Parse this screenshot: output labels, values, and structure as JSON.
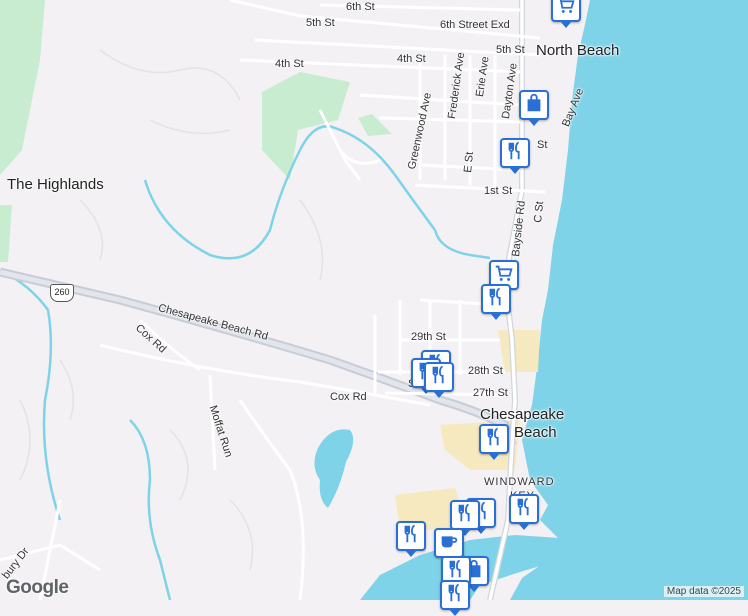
{
  "map": {
    "places": {
      "north_beach": "North Beach",
      "the_highlands": "The Highlands",
      "chesapeake_line1": "Chesapeake",
      "chesapeake_line2": "Beach",
      "windward_line1": "WINDWARD",
      "windward_line2": "KEY"
    },
    "streets": {
      "s6th": "6th St",
      "s6th_exd": "6th Street Exd",
      "s5th_a": "5th St",
      "s5th_b": "5th St",
      "s4th_a": "4th St",
      "s4th_b": "4th St",
      "s1st": "1st St",
      "s29th": "29th St",
      "s28th": "28th St",
      "s27th": "27th St",
      "chesapeake_beach_rd": "Chesapeake Beach Rd",
      "cox_rd_a": "Cox Rd",
      "cox_rd_b": "Cox Rd",
      "moffat_run": "Moffat Run",
      "greenwood_ave": "Greenwood Ave",
      "frederick_ave": "Frederick Ave",
      "erie_ave": "Erie Ave",
      "dayton_ave": "Dayton Ave",
      "bay_ave": "Bay Ave",
      "bayside_rd": "Bayside Rd",
      "c_st": "C St",
      "e_st": "E St",
      "d_st_partial": "St",
      "bury_dr": "bury Dr",
      "s_partial": "S"
    },
    "route_shield": "260",
    "colors": {
      "water": "#7fd3e8",
      "land": "#f3f1f4",
      "park": "#c8ecd0",
      "highway": "#c8ccd6",
      "sand": "#f6e9bf",
      "pin_border": "#2a6fd6"
    }
  },
  "markers": [
    {
      "icon": "cart-icon"
    },
    {
      "icon": "shopping-bag-icon"
    },
    {
      "icon": "restaurant-icon"
    },
    {
      "icon": "cart-icon"
    },
    {
      "icon": "restaurant-icon"
    },
    {
      "icon": "restaurant-icon"
    },
    {
      "icon": "restaurant-icon"
    },
    {
      "icon": "restaurant-icon"
    },
    {
      "icon": "restaurant-icon"
    },
    {
      "icon": "restaurant-icon"
    },
    {
      "icon": "restaurant-icon"
    },
    {
      "icon": "coffee-icon"
    },
    {
      "icon": "restaurant-icon"
    },
    {
      "icon": "shopping-bag-icon"
    },
    {
      "icon": "restaurant-icon"
    }
  ],
  "branding": {
    "logo": "Google",
    "attribution": "Map data ©2025"
  }
}
